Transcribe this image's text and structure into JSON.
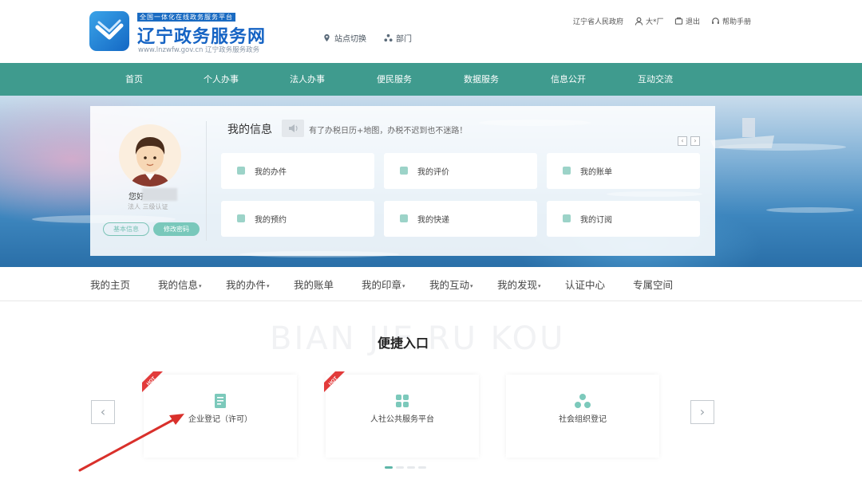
{
  "header": {
    "tagline": "全国一体化在线政务服务平台",
    "title": "辽宁政务服务网",
    "url_text": "www.lnzwfw.gov.cn  辽宁政务服务政务",
    "site_switch": "站点切换",
    "department": "部门",
    "gov_link": "辽宁省人民政府",
    "user": "大*厂",
    "logout": "退出",
    "help": "帮助手册"
  },
  "nav": {
    "items": [
      "首页",
      "个人办事",
      "法人办事",
      "便民服务",
      "数据服务",
      "信息公开",
      "互动交流"
    ]
  },
  "profile": {
    "greeting": "您好",
    "subtitle": "法人  三级认证",
    "basic_info_button": "基本信息",
    "change_password_button": "修改密码"
  },
  "info": {
    "title": "我的信息",
    "notice": "有了办税日历+地图，办税不迟到也不迷路！",
    "cards": [
      "我的办件",
      "我的评价",
      "我的账单",
      "我的预约",
      "我的快递",
      "我的订阅"
    ]
  },
  "subnav": {
    "items": [
      {
        "label": "我的主页",
        "caret": ""
      },
      {
        "label": "我的信息",
        "caret": "▾"
      },
      {
        "label": "我的办件",
        "caret": "▾"
      },
      {
        "label": "我的账单",
        "caret": ""
      },
      {
        "label": "我的印章",
        "caret": "▾"
      },
      {
        "label": "我的互动",
        "caret": "▾"
      },
      {
        "label": "我的发现",
        "caret": "▾"
      },
      {
        "label": "认证中心",
        "caret": ""
      },
      {
        "label": "专属空间",
        "caret": ""
      }
    ]
  },
  "quick_entry": {
    "background_text": "BIAN JIE RU KOU",
    "title": "便捷入口",
    "hot_label": "HOT",
    "items": [
      "企业登记（许可）",
      "人社公共服务平台",
      "社会组织登记"
    ]
  },
  "colors": {
    "nav_bg": "#3f9b8e",
    "brand_blue": "#1664c4",
    "accent_teal": "#79c8bb",
    "hot_red": "#e23b3b",
    "arrow_red": "#d9302b"
  }
}
